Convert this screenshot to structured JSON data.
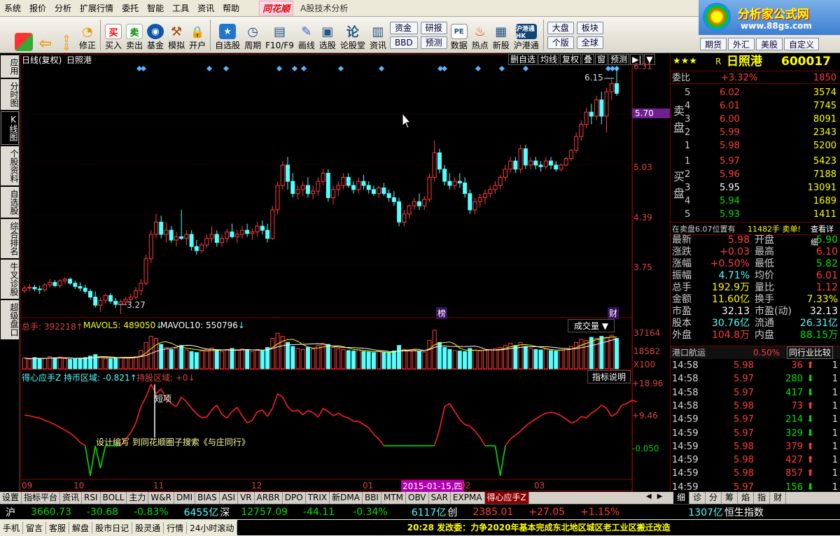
{
  "menu": {
    "items": [
      "系统",
      "报价",
      "分析",
      "扩展行情",
      "委托",
      "智能",
      "工具",
      "资讯",
      "帮助"
    ],
    "brand": "同花顺",
    "subtitle": "A股技术分析"
  },
  "brand": {
    "line1": "分析家公式网",
    "line2": "www.88gs.com"
  },
  "toolbar": {
    "buttons": [
      "修正",
      "买入",
      "卖出",
      "基金",
      "模拟",
      "开户",
      "自选股",
      "周期",
      "F10/F9",
      "画线",
      "选股",
      "论股堂",
      "资讯",
      "数据",
      "热点",
      "新股",
      "沪港通"
    ],
    "pairs": [
      [
        "资金",
        "BBD"
      ],
      [
        "研报",
        "预测"
      ],
      [
        "大盘",
        "个版"
      ],
      [
        "板块",
        "全球"
      ]
    ],
    "extra": [
      "期货",
      "外汇",
      "美股",
      "自定义"
    ],
    "logo_hk": "沪港通 HK"
  },
  "leftnav": [
    "应用",
    "分时图",
    "K线图",
    "个股资料",
    "自选股",
    "综合排名",
    "牛叉诊股",
    "超级盘口"
  ],
  "chart": {
    "title": "日线(复权)",
    "stock": "日照港",
    "top_buttons": [
      "删自选",
      "均线",
      "复权",
      "叠",
      "窗",
      "预测"
    ],
    "price_axis": [
      "6.31",
      "5.70",
      "5.03",
      "4.39",
      "3.75"
    ],
    "cur_price": "5.70",
    "hi_label": "6.15",
    "lo_label": "3.27",
    "events": [
      "榜",
      "财"
    ],
    "vol": {
      "label": "总手: 392218",
      "ma5": "MAVOL5: 489050",
      "ma10": "MAVOL10: 550796",
      "name": "成交量",
      "axis": [
        "37164",
        "18582",
        "X100"
      ]
    },
    "ind": {
      "label": "得心应手Z 持币区域: -0.821",
      "label2": "持股区域: +0",
      "name": "指标说明",
      "axis": [
        "+18.96",
        "+9.46",
        "-0.050"
      ],
      "short": "短项",
      "note": "设计编写 到同花顺圈子搜索《与庄同行》"
    },
    "dates": [
      "09",
      "10",
      "11",
      "12",
      "01",
      "02",
      "03"
    ],
    "cursor_date": "2015-01-15,四"
  },
  "chart_data": {
    "type": "candlestick",
    "candles": [
      [
        3.56,
        3.62,
        3.53,
        3.59
      ],
      [
        3.59,
        3.64,
        3.55,
        3.6
      ],
      [
        3.6,
        3.63,
        3.55,
        3.58
      ],
      [
        3.58,
        3.62,
        3.52,
        3.57
      ],
      [
        3.57,
        3.65,
        3.54,
        3.63
      ],
      [
        3.63,
        3.7,
        3.6,
        3.66
      ],
      [
        3.66,
        3.69,
        3.6,
        3.62
      ],
      [
        3.62,
        3.7,
        3.59,
        3.68
      ],
      [
        3.68,
        3.72,
        3.64,
        3.7
      ],
      [
        3.7,
        3.72,
        3.63,
        3.65
      ],
      [
        3.65,
        3.68,
        3.58,
        3.61
      ],
      [
        3.61,
        3.66,
        3.55,
        3.59
      ],
      [
        3.59,
        3.63,
        3.52,
        3.55
      ],
      [
        3.55,
        3.58,
        3.45,
        3.48
      ],
      [
        3.48,
        3.55,
        3.35,
        3.38
      ],
      [
        3.38,
        3.48,
        3.3,
        3.44
      ],
      [
        3.44,
        3.52,
        3.4,
        3.5
      ],
      [
        3.5,
        3.53,
        3.4,
        3.43
      ],
      [
        3.43,
        3.47,
        3.35,
        3.39
      ],
      [
        3.39,
        3.45,
        3.27,
        3.42
      ],
      [
        3.42,
        3.48,
        3.38,
        3.45
      ],
      [
        3.45,
        3.52,
        3.41,
        3.48
      ],
      [
        3.48,
        3.6,
        3.45,
        3.56
      ],
      [
        3.56,
        3.7,
        3.5,
        3.65
      ],
      [
        3.65,
        4.0,
        3.62,
        3.95
      ],
      [
        3.95,
        4.3,
        3.9,
        4.25
      ],
      [
        4.25,
        4.5,
        4.2,
        4.4
      ],
      [
        4.4,
        4.48,
        4.2,
        4.25
      ],
      [
        4.25,
        4.4,
        4.15,
        4.3
      ],
      [
        4.3,
        4.35,
        4.15,
        4.18
      ],
      [
        4.18,
        4.28,
        4.1,
        4.22
      ],
      [
        4.22,
        4.55,
        4.18,
        4.2
      ],
      [
        4.2,
        4.3,
        4.12,
        4.25
      ],
      [
        4.25,
        4.3,
        4.05,
        4.1
      ],
      [
        4.1,
        4.18,
        4.0,
        4.05
      ],
      [
        4.05,
        4.15,
        4.02,
        4.12
      ],
      [
        4.12,
        4.25,
        4.08,
        4.2
      ],
      [
        4.2,
        4.35,
        4.15,
        4.25
      ],
      [
        4.25,
        4.3,
        4.1,
        4.15
      ],
      [
        4.15,
        4.25,
        4.1,
        4.2
      ],
      [
        4.2,
        4.32,
        4.15,
        4.28
      ],
      [
        4.28,
        4.38,
        4.2,
        4.22
      ],
      [
        4.22,
        4.3,
        4.15,
        4.25
      ],
      [
        4.25,
        4.35,
        4.2,
        4.3
      ],
      [
        4.3,
        4.38,
        4.22,
        4.26
      ],
      [
        4.26,
        4.32,
        4.18,
        4.28
      ],
      [
        4.28,
        4.4,
        4.22,
        4.35
      ],
      [
        4.35,
        4.42,
        4.25,
        4.3
      ],
      [
        4.3,
        4.38,
        4.15,
        4.2
      ],
      [
        4.2,
        4.6,
        4.18,
        4.55
      ],
      [
        4.55,
        4.9,
        4.5,
        4.85
      ],
      [
        4.85,
        5.15,
        4.8,
        5.1
      ],
      [
        5.1,
        5.2,
        4.8,
        4.9
      ],
      [
        4.9,
        5.0,
        4.7,
        4.75
      ],
      [
        4.75,
        4.85,
        4.68,
        4.8
      ],
      [
        4.8,
        4.9,
        4.72,
        4.85
      ],
      [
        4.85,
        4.95,
        4.7,
        4.75
      ],
      [
        4.75,
        4.85,
        4.68,
        4.78
      ],
      [
        4.78,
        4.95,
        4.72,
        4.9
      ],
      [
        4.9,
        5.05,
        4.85,
        5.0
      ],
      [
        5.0,
        5.05,
        4.65,
        4.7
      ],
      [
        4.7,
        4.85,
        4.62,
        4.8
      ],
      [
        4.8,
        4.9,
        4.72,
        4.85
      ],
      [
        4.85,
        5.0,
        4.8,
        4.95
      ],
      [
        4.95,
        5.0,
        4.82,
        4.85
      ],
      [
        4.85,
        4.9,
        4.75,
        4.8
      ],
      [
        4.8,
        4.95,
        4.75,
        4.9
      ],
      [
        4.9,
        4.98,
        4.8,
        4.85
      ],
      [
        4.85,
        4.9,
        4.75,
        4.8
      ],
      [
        4.8,
        4.85,
        4.72,
        4.75
      ],
      [
        4.75,
        4.85,
        4.7,
        4.82
      ],
      [
        4.82,
        4.88,
        4.72,
        4.75
      ],
      [
        4.75,
        4.8,
        4.65,
        4.7
      ],
      [
        4.7,
        4.78,
        4.6,
        4.65
      ],
      [
        4.65,
        4.7,
        4.35,
        4.4
      ],
      [
        4.4,
        4.55,
        4.35,
        4.5
      ],
      [
        4.5,
        4.62,
        4.45,
        4.6
      ],
      [
        4.6,
        4.7,
        4.55,
        4.65
      ],
      [
        4.65,
        4.75,
        4.55,
        4.6
      ],
      [
        4.6,
        4.72,
        4.55,
        4.68
      ],
      [
        4.68,
        5.0,
        4.65,
        4.95
      ],
      [
        4.95,
        5.4,
        4.9,
        5.25
      ],
      [
        5.25,
        5.3,
        5.0,
        5.05
      ],
      [
        5.05,
        5.1,
        4.85,
        4.9
      ],
      [
        4.9,
        5.0,
        4.8,
        4.85
      ],
      [
        4.85,
        4.95,
        4.8,
        4.9
      ],
      [
        4.9,
        5.0,
        4.82,
        4.88
      ],
      [
        4.88,
        4.95,
        4.7,
        4.75
      ],
      [
        4.75,
        4.8,
        4.5,
        4.55
      ],
      [
        4.55,
        4.7,
        4.5,
        4.65
      ],
      [
        4.65,
        4.75,
        4.58,
        4.7
      ],
      [
        4.7,
        4.8,
        4.62,
        4.75
      ],
      [
        4.75,
        4.85,
        4.7,
        4.8
      ],
      [
        4.8,
        4.9,
        4.75,
        4.85
      ],
      [
        4.85,
        4.98,
        4.8,
        4.95
      ],
      [
        4.95,
        5.1,
        4.9,
        5.05
      ],
      [
        5.05,
        5.2,
        5.0,
        5.15
      ],
      [
        5.15,
        5.2,
        5.0,
        5.05
      ],
      [
        5.05,
        5.35,
        5.0,
        5.3
      ],
      [
        5.3,
        5.35,
        5.05,
        5.1
      ],
      [
        5.1,
        5.2,
        5.05,
        5.15
      ],
      [
        5.15,
        5.2,
        5.05,
        5.1
      ],
      [
        5.1,
        5.15,
        5.02,
        5.08
      ],
      [
        5.08,
        5.2,
        5.05,
        5.15
      ],
      [
        5.15,
        5.2,
        5.05,
        5.1
      ],
      [
        5.1,
        5.15,
        5.02,
        5.05
      ],
      [
        5.05,
        5.12,
        5.02,
        5.1
      ],
      [
        5.1,
        5.2,
        5.08,
        5.18
      ],
      [
        5.18,
        5.3,
        5.15,
        5.28
      ],
      [
        5.28,
        5.5,
        5.25,
        5.45
      ],
      [
        5.45,
        5.65,
        5.4,
        5.6
      ],
      [
        5.6,
        5.8,
        5.55,
        5.75
      ],
      [
        5.75,
        5.85,
        5.6,
        5.7
      ],
      [
        5.7,
        5.95,
        5.65,
        5.9
      ],
      [
        5.9,
        6.0,
        5.6,
        5.7
      ],
      [
        5.7,
        6.05,
        5.5,
        6.0
      ],
      [
        6.0,
        6.15,
        5.9,
        6.1
      ],
      [
        6.1,
        6.31,
        5.95,
        5.98
      ]
    ],
    "volume": [
      105,
      95,
      110,
      98,
      102,
      120,
      108,
      115,
      100,
      92,
      96,
      104,
      110,
      125,
      140,
      118,
      105,
      98,
      102,
      110,
      112,
      108,
      120,
      180,
      260,
      320,
      300,
      240,
      210,
      190,
      200,
      230,
      185,
      170,
      160,
      175,
      190,
      205,
      180,
      170,
      190,
      200,
      185,
      195,
      180,
      170,
      190,
      175,
      210,
      300,
      350,
      320,
      260,
      220,
      200,
      190,
      210,
      195,
      230,
      250,
      240,
      210,
      200,
      190,
      180,
      175,
      185,
      170,
      165,
      160,
      170,
      160,
      155,
      175,
      230,
      190,
      180,
      185,
      170,
      165,
      280,
      380,
      260,
      210,
      190,
      180,
      175,
      170,
      200,
      185,
      175,
      180,
      190,
      200,
      210,
      230,
      250,
      230,
      260,
      220,
      200,
      190,
      185,
      195,
      180,
      175,
      185,
      200,
      220,
      260,
      290,
      280,
      310,
      300,
      320,
      310,
      330,
      300
    ],
    "indicator": [
      9.4,
      9.2,
      8.8,
      8.5,
      7.8,
      7.2,
      6.5,
      5.6,
      4.8,
      3.8,
      2.6,
      1.0,
      -0.05,
      -2.0,
      -0.05,
      -1.5,
      -0.05,
      -0.05,
      -0.05,
      -0.05,
      2.0,
      4.0,
      7.0,
      12.0,
      15.0,
      18.96,
      16.0,
      17.5,
      14.5,
      13.0,
      12.0,
      15.0,
      13.5,
      11.5,
      9.8,
      8.6,
      8.8,
      11.0,
      12.5,
      9.6,
      8.5,
      10.5,
      11.8,
      9.2,
      7.0,
      7.8,
      10.5,
      11.0,
      9.0,
      11.5,
      16.0,
      15.0,
      12.0,
      10.5,
      11.0,
      9.5,
      10.8,
      10.2,
      8.8,
      11.5,
      10.5,
      9.2,
      10.0,
      9.0,
      8.5,
      7.5,
      7.5,
      6.5,
      5.5,
      3.5,
      2.0,
      -0.05,
      -0.05,
      -0.05,
      -0.05,
      -0.05,
      -0.05,
      -0.05,
      -0.05,
      -0.05,
      -0.05,
      -0.05,
      5.0,
      12.0,
      13.0,
      10.5,
      8.0,
      6.5,
      6.0,
      4.5,
      2.5,
      -0.05,
      -0.05,
      -0.05,
      -2.0,
      -0.05,
      2.0,
      3.2,
      4.5,
      6.0,
      7.2,
      8.2,
      9.2,
      10.0,
      10.3,
      10.0,
      9.2,
      8.2,
      7.0,
      7.5,
      9.0,
      8.5,
      10.0,
      11.0,
      12.5,
      11.5,
      9.0,
      10.0,
      12.5,
      13.0,
      14.0,
      13.5
    ],
    "ylim": [
      3.27,
      6.31
    ]
  },
  "quote": {
    "stars": "★★★",
    "rating": "R",
    "name": "日照港",
    "code": "600017",
    "weibi": {
      "label": "委比",
      "pct": "+3.32%",
      "diff": "1850"
    },
    "sell": [
      [
        "5",
        "6.02",
        "3574"
      ],
      [
        "4",
        "6.01",
        "7745"
      ],
      [
        "3",
        "6.00",
        "8091"
      ],
      [
        "2",
        "5.99",
        "2343"
      ],
      [
        "1",
        "5.98",
        "5200"
      ]
    ],
    "buy": [
      [
        "1",
        "5.97",
        "5423"
      ],
      [
        "2",
        "5.96",
        "7188"
      ],
      [
        "3",
        "5.95",
        "13091"
      ],
      [
        "4",
        "5.94",
        "1689"
      ],
      [
        "5",
        "5.93",
        "1411"
      ]
    ],
    "sell_label": [
      "卖",
      "盘"
    ],
    "buy_label": [
      "买",
      "盘"
    ],
    "notice": "在卖盘6.07位置有",
    "notice2": "11482手 卖单!",
    "notice3": "查看详细",
    "stats": [
      [
        "最新",
        "5.98",
        "开盘",
        "5.90"
      ],
      [
        "涨跌",
        "+0.03",
        "最高",
        "6.10"
      ],
      [
        "涨幅",
        "+0.50%",
        "最低",
        "5.82"
      ],
      [
        "振幅",
        "4.71%",
        "均价",
        "6.01"
      ],
      [
        "总手",
        "192.9万",
        "量比",
        "1.12"
      ],
      [
        "金额",
        "11.60亿",
        "换手",
        "7.33%"
      ],
      [
        "市盈",
        "32.13",
        "市盈(动)",
        "32.13"
      ],
      [
        "股本",
        "30.76亿",
        "流通",
        "26.31亿"
      ],
      [
        "外盘",
        "104.8万",
        "内盘",
        "88.15万"
      ]
    ],
    "industry": {
      "name": "港口航运",
      "pct": "0.50%",
      "btn": "同行业比较"
    },
    "ticks": [
      [
        "14:58",
        "5.98",
        "36",
        "up"
      ],
      [
        "14:58",
        "5.97",
        "280",
        "dn"
      ],
      [
        "14:58",
        "5.97",
        "417",
        "dn"
      ],
      [
        "14:58",
        "5.98",
        "73",
        "up"
      ],
      [
        "14:59",
        "5.97",
        "214",
        "dn"
      ],
      [
        "14:59",
        "5.97",
        "329",
        "dn"
      ],
      [
        "14:59",
        "5.98",
        "379",
        "up"
      ],
      [
        "14:59",
        "5.98",
        "427",
        "up"
      ],
      [
        "14:59",
        "5.98",
        "857",
        "up"
      ],
      [
        "14:59",
        "5.97",
        "156",
        "dn"
      ]
    ]
  },
  "bottomtabs": [
    "设置",
    "指标平台",
    "资讯",
    "RSI",
    "BOLL",
    "主力",
    "W&R",
    "DMI",
    "BIAS",
    "ASI",
    "VR",
    "ARBR",
    "DPO",
    "TRIX",
    "新DMA",
    "BBI",
    "MTM",
    "OBV",
    "SAR",
    "EXPMA",
    "得心应手Z"
  ],
  "righttabs": [
    "细",
    "诊",
    "分",
    "筹",
    "焰",
    "指",
    "财"
  ],
  "index": {
    "sh": "沪",
    "sh_v": "3660.73",
    "sh_c": "-30.68",
    "sh_p": "-0.83%",
    "sh_a": "6455亿",
    "sz": "深",
    "sz_v": "12757.09",
    "sz_c": "-44.11",
    "sz_p": "-0.34%",
    "sz_a": "6117亿",
    "cy": "创",
    "cy_v": "2385.01",
    "cy_c": "+27.05",
    "cy_p": "+1.15%",
    "cy_a": "1307亿",
    "hk": "恒生指数"
  },
  "status": {
    "items": [
      "手机",
      "留言",
      "客服",
      "解盘",
      "股市日记",
      "股灵通",
      "行情",
      "24小时滚动"
    ],
    "ticker": "20:28 发改委：力争2020年基本完成东北地区城区老工业区搬迁改造"
  }
}
